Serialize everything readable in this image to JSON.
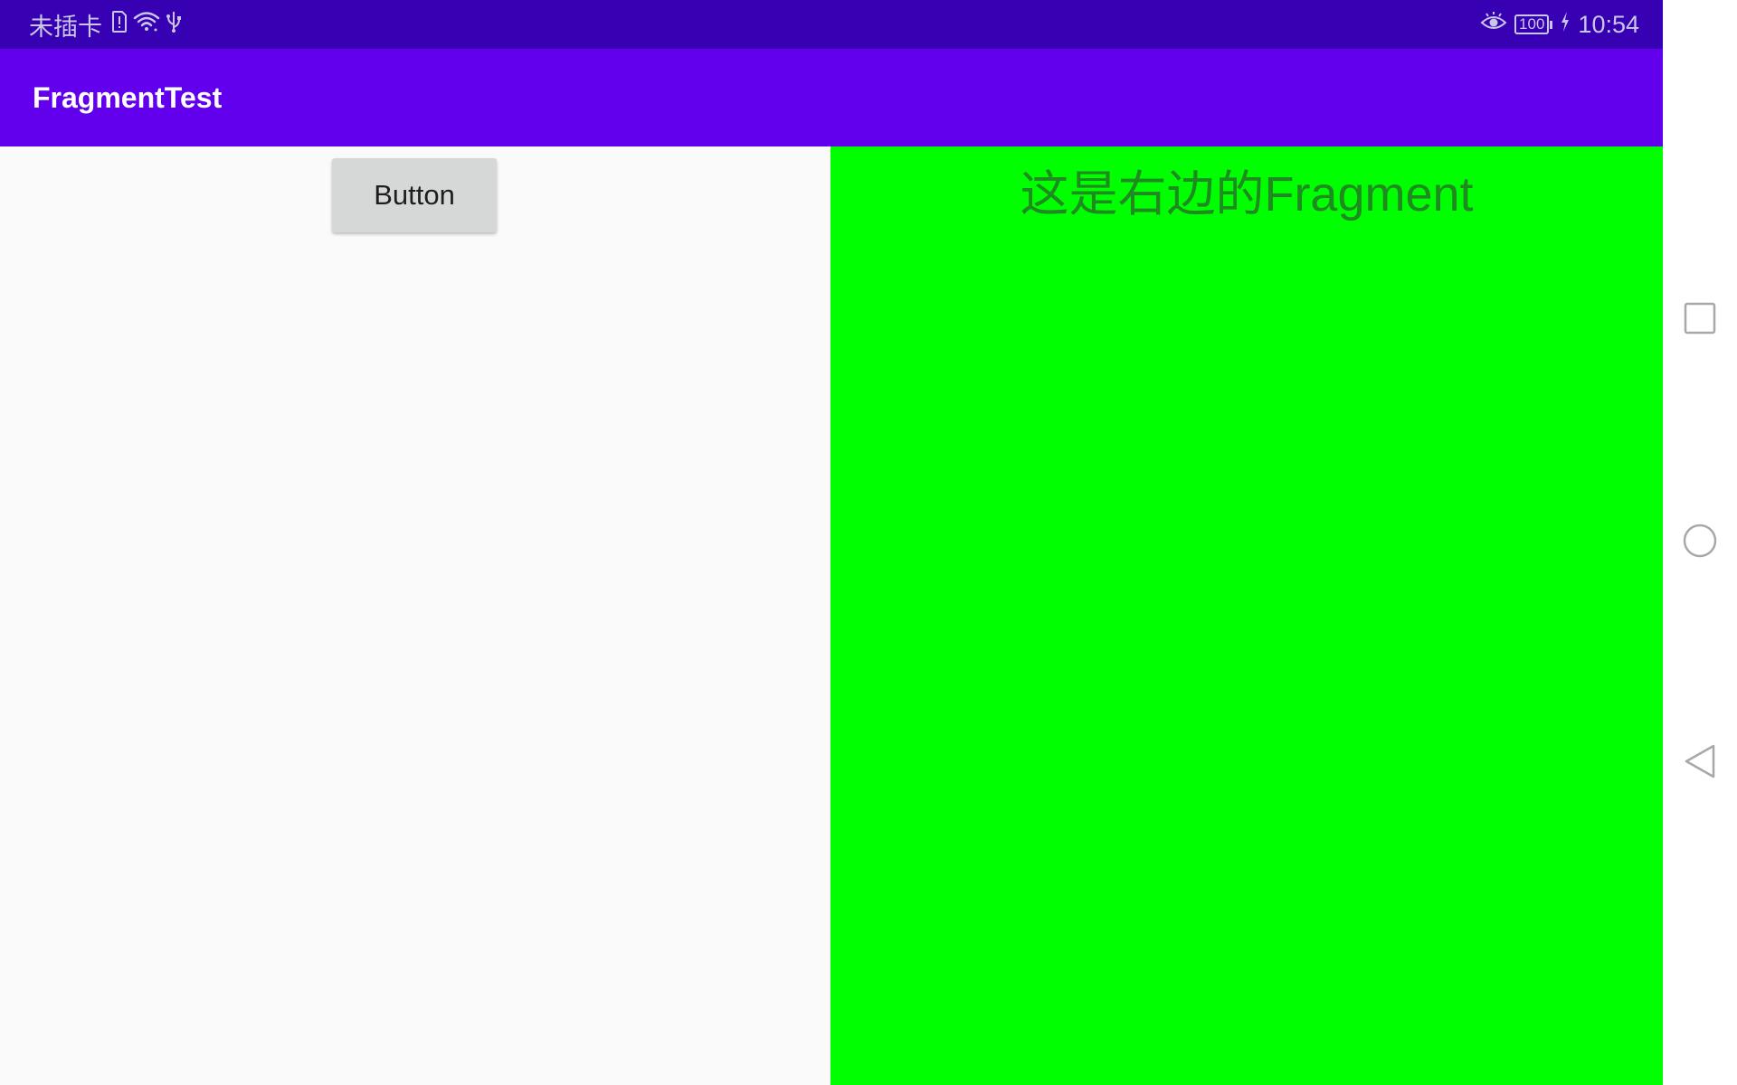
{
  "status_bar": {
    "carrier": "未插卡",
    "time": "10:54",
    "battery_level": "100",
    "icons": [
      "sim-alert-icon",
      "wifi-icon",
      "usb-icon",
      "eye-comfort-icon",
      "battery-icon",
      "charging-icon"
    ]
  },
  "app_bar": {
    "title": "FragmentTest"
  },
  "left_fragment": {
    "button_label": "Button"
  },
  "right_fragment": {
    "text": "这是右边的Fragment",
    "background": "#00ff00"
  },
  "colors": {
    "status_bar": "#3700b3",
    "app_bar": "#6200ee",
    "left_background": "#fafafa",
    "button": "#d6d7d7"
  },
  "nav_bar": {
    "icons": [
      "recents-icon",
      "home-icon",
      "back-icon"
    ]
  }
}
